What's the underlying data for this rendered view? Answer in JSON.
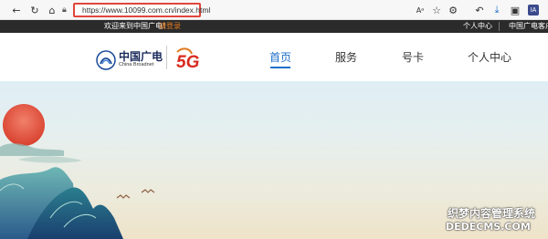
{
  "browser": {
    "url": "https://www.10099.com.cn/index.html",
    "icons": [
      "back-icon",
      "refresh-icon",
      "home-icon",
      "lock-icon",
      "read-aloud-icon",
      "favorite-icon",
      "settings-icon",
      "bookmark-icon",
      "reply-icon",
      "download-icon",
      "collections-icon",
      "profile-icon"
    ],
    "profile_initials": "IA"
  },
  "topbar": {
    "welcome": "欢迎来到中国广电！",
    "login": "请登录",
    "user_center": "个人中心",
    "customer": "中国广电客户"
  },
  "header": {
    "logo_cn": "中国广电",
    "logo_en": "China Broadnet",
    "badge": "5G",
    "nav": [
      "首页",
      "服务",
      "号卡",
      "个人中心"
    ],
    "active_nav": "首页"
  },
  "watermark": {
    "line1": "织梦内容管理系统",
    "line2": "DEDECMS.COM"
  },
  "colors": {
    "accent": "#1c6fc8",
    "login_orange": "#e07a1f",
    "topbar_bg": "#2b2b2b",
    "highlight_red": "#e0463c"
  }
}
